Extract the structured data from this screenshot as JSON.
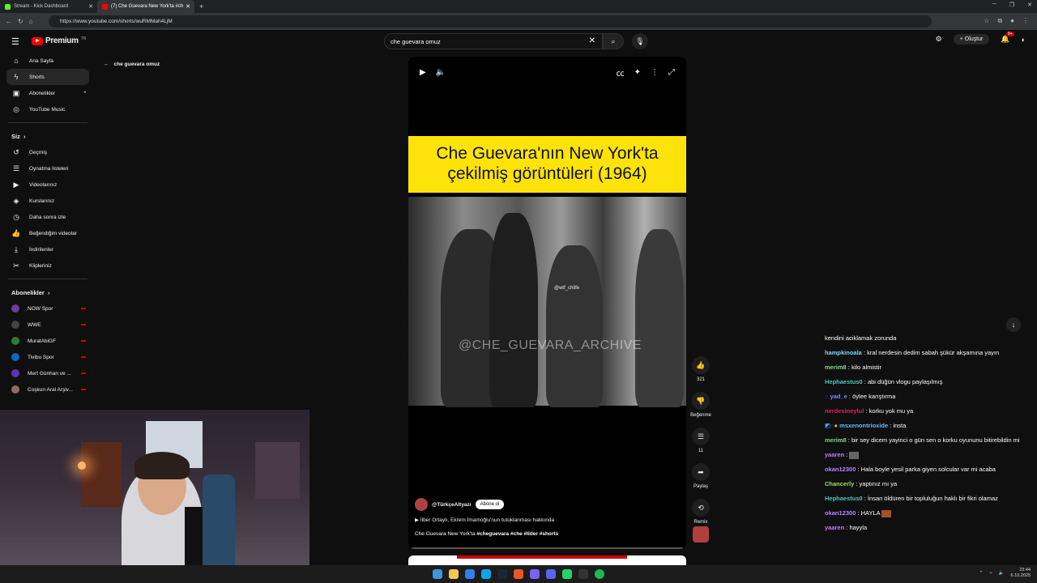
{
  "browser": {
    "tabs": [
      {
        "title": "Stream - Kick Dashboard",
        "color": "#53fc18"
      },
      {
        "title": "(7) Che Guevara New York'ta #ch",
        "color": "#ff0000"
      }
    ],
    "new_tab_icon": "plus-icon",
    "url": "https://www.youtube.com/shorts/wuRMMah4LjM"
  },
  "youtube": {
    "logo_text": "Premium",
    "logo_region": "TR",
    "search_value": "che guevara omuz",
    "create_label": "Oluştur",
    "notification_count": "9+",
    "back_label": "che guevara omuz"
  },
  "sidebar": {
    "main": [
      {
        "label": "Ana Sayfa",
        "icon": "home-icon"
      },
      {
        "label": "Shorts",
        "icon": "shorts-icon"
      },
      {
        "label": "Abonelikler",
        "icon": "subscriptions-icon"
      },
      {
        "label": "YouTube Music",
        "icon": "music-icon"
      }
    ],
    "you_header": "Siz",
    "you": [
      {
        "label": "Geçmiş",
        "icon": "history-icon"
      },
      {
        "label": "Oynatma listeleri",
        "icon": "playlist-icon"
      },
      {
        "label": "Videolarınız",
        "icon": "video-icon"
      },
      {
        "label": "Kurslarınız",
        "icon": "course-icon"
      },
      {
        "label": "Daha sonra izle",
        "icon": "clock-icon"
      },
      {
        "label": "Beğendiğim videolar",
        "icon": "like-icon"
      },
      {
        "label": "İndirilenler",
        "icon": "download-icon"
      },
      {
        "label": "Klipleriniz",
        "icon": "scissors-icon"
      }
    ],
    "subs_header": "Abonelikler",
    "subs": [
      {
        "label": "NOW Spor",
        "color": "#6a3d9a"
      },
      {
        "label": "WWE",
        "color": "#222222"
      },
      {
        "label": "MuratAbiGF",
        "color": "#2e7d32"
      },
      {
        "label": "Tivibu Spor",
        "color": "#1565c0"
      },
      {
        "label": "Mert Günhan ve ...",
        "color": "#5e35b1"
      },
      {
        "label": "Coşkun Aral Arşiv...",
        "color": "#8d6e63"
      }
    ]
  },
  "video": {
    "headline_line1": "Che Guevara'nın New York'ta",
    "headline_line2": "çekilmiş görüntüleri (1964)",
    "watermark_small": "@wtf_chlife",
    "watermark_large": "@CHE_GUEVARA_ARCHIVE",
    "channel": "@TürkçeAltyazı",
    "subscribe_label": "Abone ol",
    "related": "İlber Ortaylı, Ekrem İmamoğlu'nun tutuklanması hakkında",
    "title_plain": "Che Guevara New York'ta",
    "title_tags": "#cheguevara #che #lider #shorts",
    "progress": 0
  },
  "actions": {
    "like_count": "321",
    "dislike_label": "Beğenme",
    "comment_count": "11",
    "share_label": "Paylaş",
    "remix_label": "Remix"
  },
  "chat": [
    {
      "user": "",
      "text": "kendini aciklamak zorunda",
      "color": "#ffffff"
    },
    {
      "user": "hampkinoala",
      "text": "kral nerdesin dedim sabah şükür akşamına yayın",
      "color": "#7fd8ff"
    },
    {
      "user": "merim8",
      "text": "kilo almistir",
      "color": "#7bdc8a"
    },
    {
      "user": "Hephaestus0",
      "text": "abi düğün vlogu paylaşılmış",
      "color": "#4fc3c3"
    },
    {
      "user": "yad_e",
      "text": "öylee karıştırma",
      "color": "#7a8cff"
    },
    {
      "user": "nerdesineylul",
      "text": "korku yok mu ya",
      "color": "#e0245e"
    },
    {
      "user": "msxenontrioxide",
      "text": "insta",
      "color": "#6bb6ff"
    },
    {
      "user": "merim8",
      "text": "bir sey dicem yayinci o gün sen o korku oyununu bitirebildin mi",
      "color": "#7bdc8a"
    },
    {
      "user": "yaaren",
      "text": "",
      "color": "#c77dff"
    },
    {
      "user": "okan12300",
      "text": "Hala boyle yesil parka giyen solcular var mi acaba",
      "color": "#b388ff"
    },
    {
      "user": "Chancerly",
      "text": "yaptınız mı ya",
      "color": "#9be15d"
    },
    {
      "user": "Hephaestus0",
      "text": "İnsan öldüren bir topluluğun haklı bir fikri olamaz",
      "color": "#4fc3c3"
    },
    {
      "user": "okan12300",
      "text": "HAYLA",
      "color": "#b388ff"
    },
    {
      "user": "yaaren",
      "text": "hayyla",
      "color": "#c77dff"
    }
  ],
  "taskbar": {
    "time": "23:44",
    "date": "6.10.2025",
    "apps": [
      "#3a96dd",
      "#f2c94c",
      "#2f80ed",
      "#0ea5e9",
      "#1b2838",
      "#e8572a",
      "#7b61ff",
      "#5865f2",
      "#25d366",
      "#333333",
      "#1db954"
    ]
  }
}
